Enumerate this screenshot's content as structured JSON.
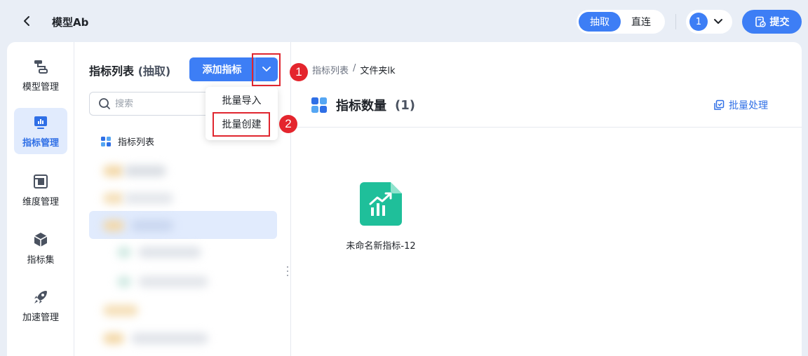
{
  "header": {
    "model_name": "模型Ab",
    "mode_options": [
      "抽取",
      "直连"
    ],
    "active_mode": "抽取",
    "user_number": "1",
    "submit_label": "提交"
  },
  "sidebar": {
    "items": [
      {
        "label": "模型管理",
        "icon": "model-icon",
        "active": false
      },
      {
        "label": "指标管理",
        "icon": "metric-chart-icon",
        "active": true
      },
      {
        "label": "维度管理",
        "icon": "dimension-icon",
        "active": false
      },
      {
        "label": "指标集",
        "icon": "cube-icon",
        "active": false
      },
      {
        "label": "加速管理",
        "icon": "rocket-icon",
        "active": false
      }
    ]
  },
  "list_panel": {
    "title": "指标列表",
    "title_suffix": "(抽取)",
    "add_button": "添加指标",
    "search_placeholder": "搜索",
    "tree_root": "指标列表"
  },
  "dropdown_menu": {
    "items": [
      "批量导入",
      "批量创建"
    ]
  },
  "annotations": {
    "step1": "1",
    "step2": "2"
  },
  "content": {
    "breadcrumb": [
      "指标列表",
      "文件夹lk"
    ],
    "breadcrumb_sep": "/",
    "title": "指标数量",
    "count": "(1)",
    "batch_button": "批量处理",
    "metrics": [
      {
        "name": "未命名新指标-12"
      }
    ]
  },
  "colors": {
    "primary": "#3d7ef5",
    "highlight_red": "#e0262f",
    "metric_icon": "#1fbf9a"
  }
}
